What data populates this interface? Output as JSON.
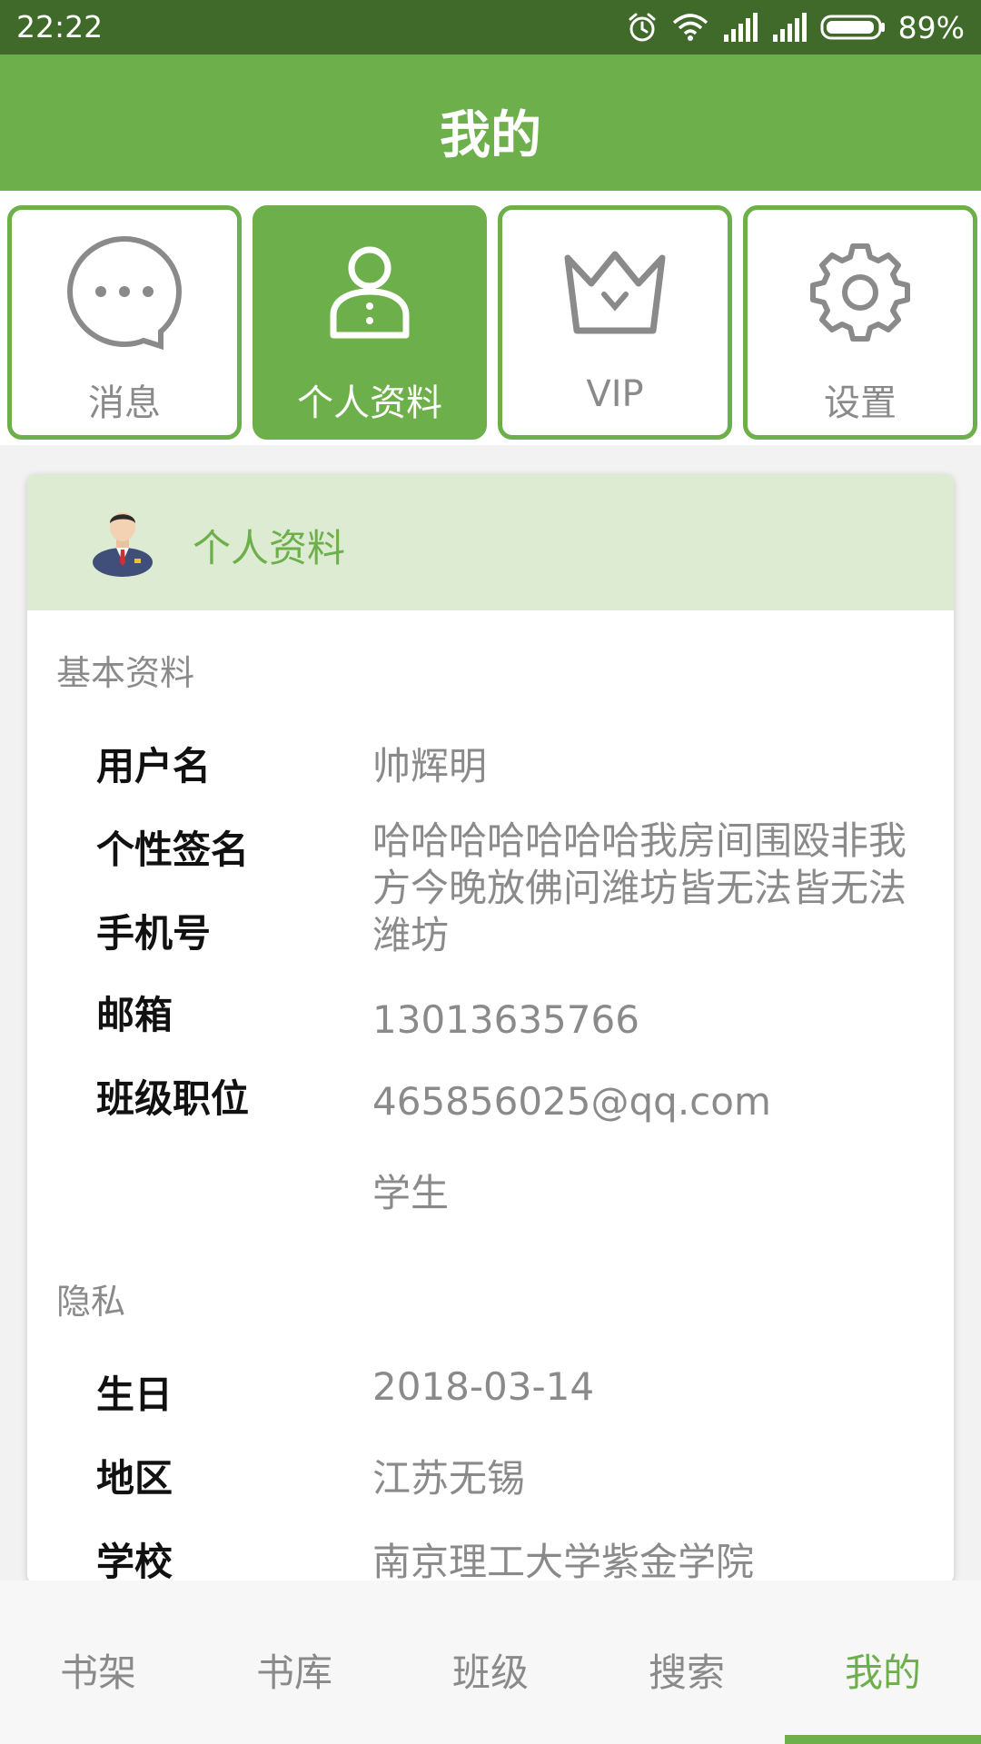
{
  "status_bar": {
    "time": "22:22",
    "battery": "89%",
    "icons": [
      "alarm-icon",
      "wifi-icon",
      "signal-icon",
      "signal-icon",
      "battery-icon"
    ]
  },
  "header": {
    "title": "我的"
  },
  "tiles": [
    {
      "label": "消息",
      "icon": "chat-bubble-icon",
      "active": false
    },
    {
      "label": "个人资料",
      "icon": "person-icon",
      "active": true
    },
    {
      "label": "VIP",
      "icon": "crown-icon",
      "active": false
    },
    {
      "label": "设置",
      "icon": "gear-icon",
      "active": false
    }
  ],
  "profile_card": {
    "title": "个人资料",
    "avatar_icon": "user-avatar-icon",
    "basic": {
      "heading": "基本资料",
      "labels": [
        "用户名",
        "个性签名",
        "手机号",
        "邮箱",
        "班级职位"
      ],
      "values": {
        "username": "帅辉明",
        "signature": "哈哈哈哈哈哈哈我房间围殴非我方今晚放佛问潍坊皆无法皆无法潍坊",
        "phone": "13013635766",
        "email": "465856025@qq.com",
        "position": "学生"
      }
    },
    "privacy": {
      "heading": "隐私",
      "labels": [
        "生日",
        "地区",
        "学校"
      ],
      "values": {
        "birthday": "2018-03-14",
        "region": "江苏无锡",
        "school": "南京理工大学紫金学院"
      }
    }
  },
  "bottom_nav": {
    "items": [
      "书架",
      "书库",
      "班级",
      "搜索",
      "我的"
    ],
    "active": "我的"
  },
  "colors": {
    "accent": "#6daf4a",
    "status_bar": "#3f6a29",
    "card_header_bg": "#dcebd2",
    "muted_text": "#8a8a8a"
  }
}
